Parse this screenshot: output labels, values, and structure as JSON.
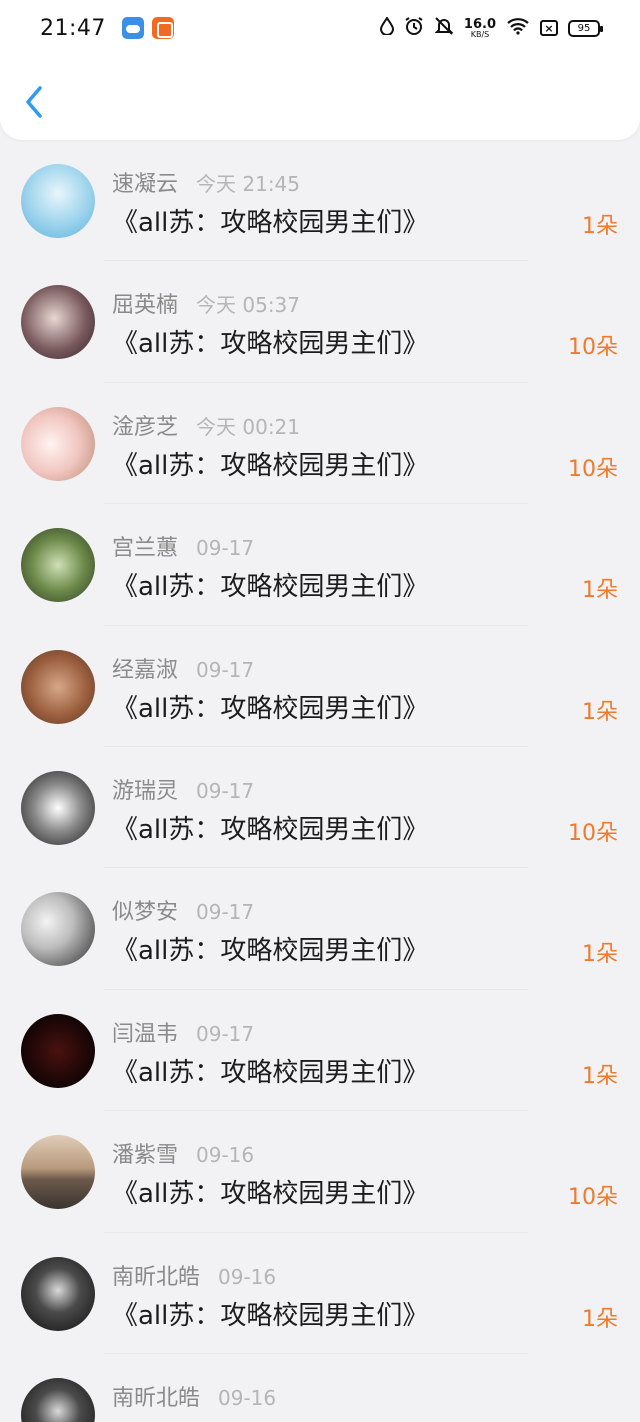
{
  "status_bar": {
    "time": "21:47",
    "net_speed_value": "16.0",
    "net_speed_unit": "KB/S",
    "battery": "95",
    "icons": [
      "water-drop-icon",
      "alarm-icon",
      "mute-bell-icon",
      "wifi-icon",
      "close-box-icon"
    ]
  },
  "nav": {
    "back_icon": "chevron-left-icon",
    "accent": "#2e9af0"
  },
  "colors": {
    "flowers": "#ef7a2a",
    "name": "#8a8a8a",
    "time": "#b5b5b5"
  },
  "rows": [
    {
      "name": "速凝云",
      "time": "今天 21:45",
      "book": "《all苏：攻略校园男主们》",
      "flowers": "1朵"
    },
    {
      "name": "屈英楠",
      "time": "今天 05:37",
      "book": "《all苏：攻略校园男主们》",
      "flowers": "10朵"
    },
    {
      "name": "淦彦芝",
      "time": "今天 00:21",
      "book": "《all苏：攻略校园男主们》",
      "flowers": "10朵"
    },
    {
      "name": "宫兰蕙",
      "time": "09-17",
      "book": "《all苏：攻略校园男主们》",
      "flowers": "1朵"
    },
    {
      "name": "经嘉淑",
      "time": "09-17",
      "book": "《all苏：攻略校园男主们》",
      "flowers": "1朵"
    },
    {
      "name": "游瑞灵",
      "time": "09-17",
      "book": "《all苏：攻略校园男主们》",
      "flowers": "10朵"
    },
    {
      "name": "似梦安",
      "time": "09-17",
      "book": "《all苏：攻略校园男主们》",
      "flowers": "1朵"
    },
    {
      "name": "闫温韦",
      "time": "09-17",
      "book": "《all苏：攻略校园男主们》",
      "flowers": "1朵"
    },
    {
      "name": "潘紫雪",
      "time": "09-16",
      "book": "《all苏：攻略校园男主们》",
      "flowers": "10朵"
    },
    {
      "name": "南昕北皓",
      "time": "09-16",
      "book": "《all苏：攻略校园男主们》",
      "flowers": "1朵"
    },
    {
      "name": "南昕北皓",
      "time": "09-16",
      "book": "",
      "flowers": ""
    }
  ]
}
